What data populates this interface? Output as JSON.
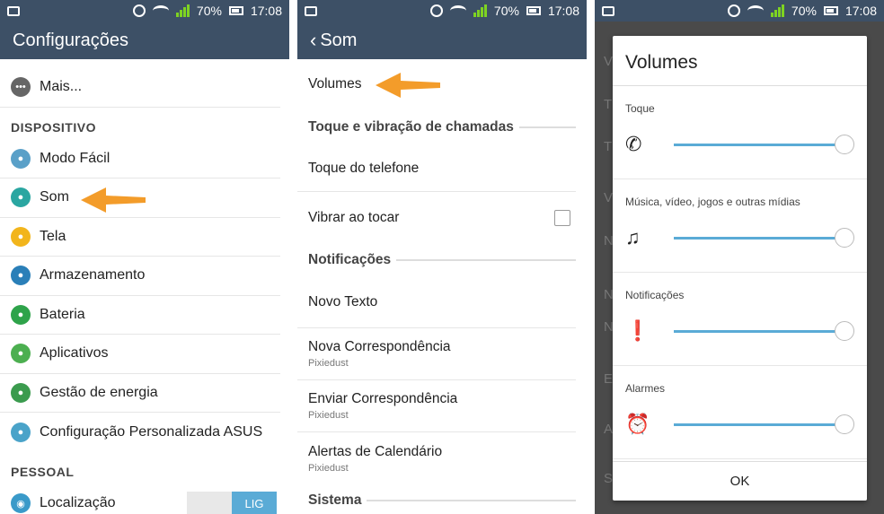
{
  "status": {
    "battery": "70%",
    "time": "17:08"
  },
  "colors": {
    "appbar": "#3d5066",
    "accent": "#5aabd6",
    "arrow": "#f39c2a"
  },
  "panel1": {
    "title": "Configurações",
    "more_item": "Mais...",
    "section_device": "DISPOSITIVO",
    "device_items": [
      {
        "label": "Modo Fácil",
        "icon": "easy-mode-icon",
        "color": "#5aa0c8"
      },
      {
        "label": "Som",
        "icon": "sound-icon",
        "color": "#2aa6a1"
      },
      {
        "label": "Tela",
        "icon": "display-icon",
        "color": "#f2b51c"
      },
      {
        "label": "Armazenamento",
        "icon": "storage-icon",
        "color": "#2a7fb8"
      },
      {
        "label": "Bateria",
        "icon": "battery-icon",
        "color": "#2ea34a"
      },
      {
        "label": "Aplicativos",
        "icon": "apps-icon",
        "color": "#4caf50"
      },
      {
        "label": "Gestão de energia",
        "icon": "power-management-icon",
        "color": "#3b9b4e"
      },
      {
        "label": "Configuração Personalizada ASUS",
        "icon": "asus-custom-icon",
        "color": "#4aa3c9"
      }
    ],
    "section_personal": "PESSOAL",
    "location_label": "Localização",
    "location_toggle": "LIG"
  },
  "panel2": {
    "back_title": "Som",
    "volumes": "Volumes",
    "section_calls": "Toque e vibração de chamadas",
    "phone_ringtone": "Toque do telefone",
    "vibrate_on_touch": "Vibrar ao tocar",
    "section_notifications": "Notificações",
    "new_text": "Novo Texto",
    "new_mail": "Nova Correspondência",
    "new_mail_sub": "Pixiedust",
    "send_mail": "Enviar Correspondência",
    "send_mail_sub": "Pixiedust",
    "calendar_alerts": "Alertas de Calendário",
    "calendar_alerts_sub": "Pixiedust",
    "section_system": "Sistema"
  },
  "panel3": {
    "dialog_title": "Volumes",
    "volumes": [
      {
        "label": "Toque",
        "icon": "ringtone-icon",
        "glyph": "✆",
        "level": 1.0
      },
      {
        "label": "Música, vídeo, jogos e outras mídias",
        "icon": "music-note-icon",
        "glyph": "♫",
        "level": 1.0
      },
      {
        "label": "Notificações",
        "icon": "notification-icon",
        "glyph": "❗",
        "level": 1.0
      },
      {
        "label": "Alarmes",
        "icon": "alarm-clock-icon",
        "glyph": "⏰",
        "level": 1.0
      }
    ],
    "ok_label": "OK",
    "background_peek": [
      "V",
      "T",
      "T",
      "V",
      "N",
      "N",
      "N",
      "E",
      "A",
      "Sistema"
    ]
  }
}
